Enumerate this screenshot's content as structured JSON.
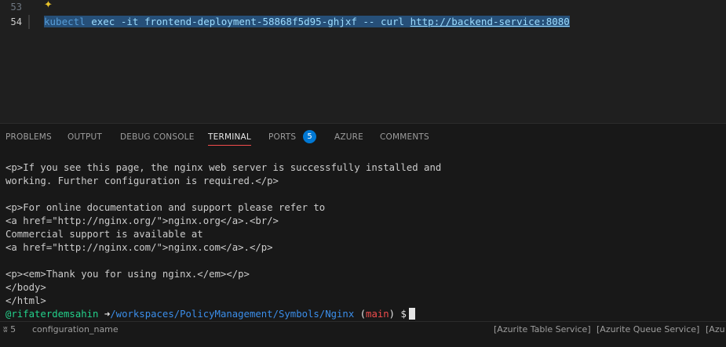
{
  "editor": {
    "lines": [
      {
        "number": "53",
        "text": ""
      },
      {
        "number": "54",
        "text": "kubectl exec -it frontend-deployment-58868f5d95-ghjxf -- curl http://backend-service:8080"
      }
    ],
    "code": {
      "cmd": "kubectl",
      "args": " exec -it frontend-deployment-58868f5d95-ghjxf -- curl ",
      "url": "http://backend-service:8080"
    },
    "sparkle_icon": "copilot-sparkle-icon"
  },
  "panel": {
    "tabs": [
      {
        "label": "PROBLEMS",
        "active": false
      },
      {
        "label": "OUTPUT",
        "active": false
      },
      {
        "label": "DEBUG CONSOLE",
        "active": false
      },
      {
        "label": "TERMINAL",
        "active": true
      },
      {
        "label": "PORTS",
        "active": false,
        "badge": "5"
      },
      {
        "label": "AZURE",
        "active": false
      },
      {
        "label": "COMMENTS",
        "active": false
      }
    ]
  },
  "terminal": {
    "lines": [
      "<p>If you see this page, the nginx web server is successfully installed and",
      "working. Further configuration is required.</p>",
      "",
      "<p>For online documentation and support please refer to",
      "<a href=\"http://nginx.org/\">nginx.org</a>.<br/>",
      "Commercial support is available at",
      "<a href=\"http://nginx.com/\">nginx.com</a>.</p>",
      "",
      "<p><em>Thank you for using nginx.</em></p>",
      "</body>",
      "</html>"
    ],
    "prompt": {
      "user": "@rifaterdemsahin",
      "arrow": "➜",
      "path": "/workspaces/PolicyManagement/Symbols/Nginx",
      "branch_open": "(",
      "branch": "main",
      "branch_close": ")",
      "dollar": "$"
    }
  },
  "statusbar": {
    "ports_icon": "ports-antenna-icon",
    "ports_count": "5",
    "config_name": "configuration_name",
    "items": [
      "[Azurite Table Service]",
      "[Azurite Queue Service]",
      "[Azu"
    ]
  },
  "colors": {
    "accent": "#0078d4",
    "active_tab_underline": "#f14c4c",
    "prompt_user": "#23d18b",
    "prompt_path": "#3b8eea",
    "prompt_branch": "#f14c4c"
  }
}
